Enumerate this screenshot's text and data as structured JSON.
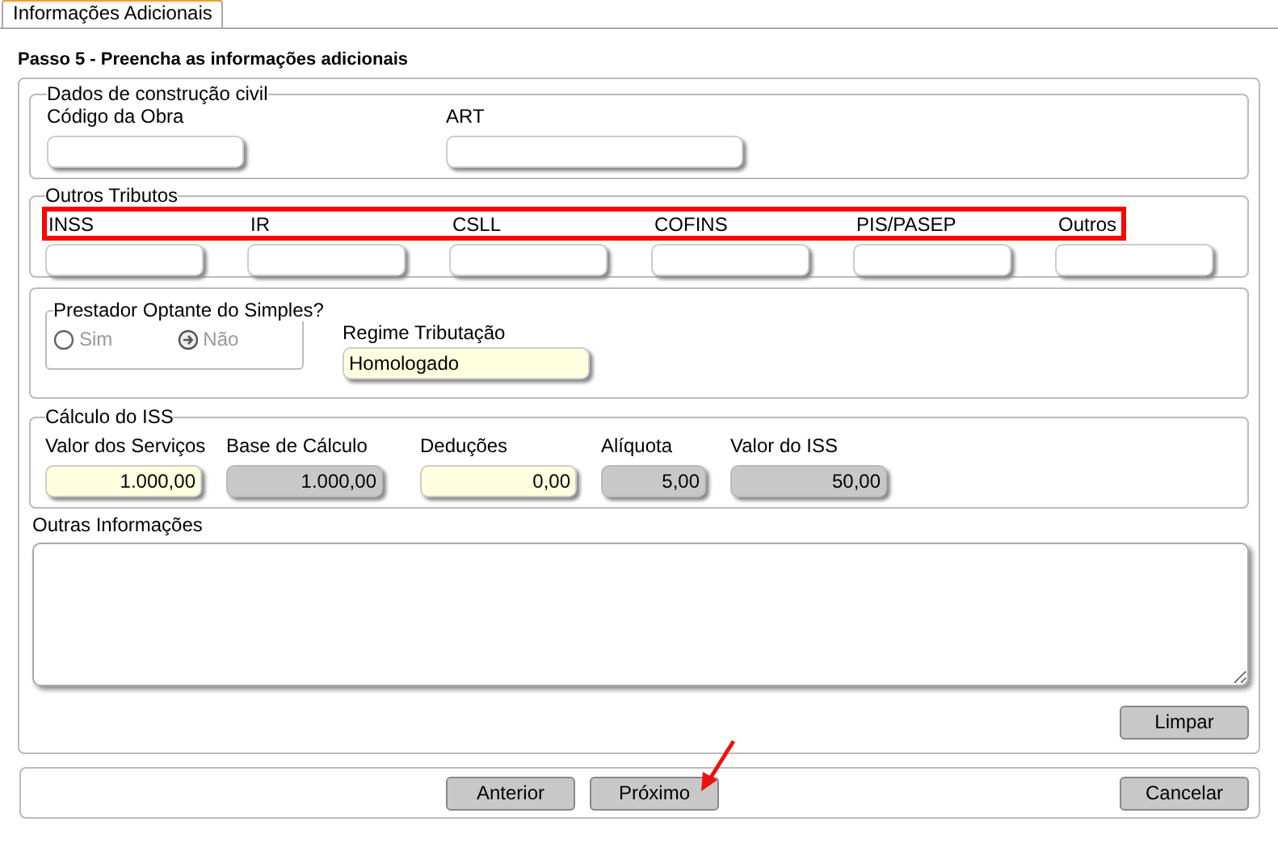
{
  "tab": {
    "label": "Informações Adicionais",
    "selected": true
  },
  "step_title": "Passo 5 - Preencha as informações adicionais",
  "construction": {
    "legend": "Dados de construção civil",
    "fields": [
      {
        "label": "Código da Obra"
      },
      {
        "label": "ART"
      }
    ]
  },
  "other_taxes": {
    "legend": "Outros Tributos",
    "fields": [
      {
        "label": "INSS"
      },
      {
        "label": "IR"
      },
      {
        "label": "CSLL"
      },
      {
        "label": "COFINS"
      },
      {
        "label": "PIS/PASEP"
      },
      {
        "label": "Outros"
      }
    ]
  },
  "simples": {
    "legend": "Prestador Optante do Simples?",
    "disabled": true,
    "options": [
      {
        "label": "Sim",
        "selected": false
      },
      {
        "label": "Não",
        "selected": true
      }
    ]
  },
  "regime": {
    "label": "Regime Tributação",
    "value": "Homologado"
  },
  "iss": {
    "legend": "Cálculo do ISS",
    "fields": [
      {
        "label": "Valor dos Serviços",
        "value": "1.000,00",
        "kind": "editable"
      },
      {
        "label": "Base de Cálculo",
        "value": "1.000,00",
        "kind": "readonly"
      },
      {
        "label": "Deduções",
        "value": "0,00",
        "kind": "editable"
      },
      {
        "label": "Alíquota",
        "value": "5,00",
        "kind": "readonly"
      },
      {
        "label": "Valor do ISS",
        "value": "50,00",
        "kind": "readonly"
      }
    ]
  },
  "notes": {
    "label": "Outras Informações"
  },
  "clear_button": "Limpar",
  "nav_buttons": [
    "Anterior",
    "Próximo"
  ],
  "cancel_button": "Cancelar"
}
